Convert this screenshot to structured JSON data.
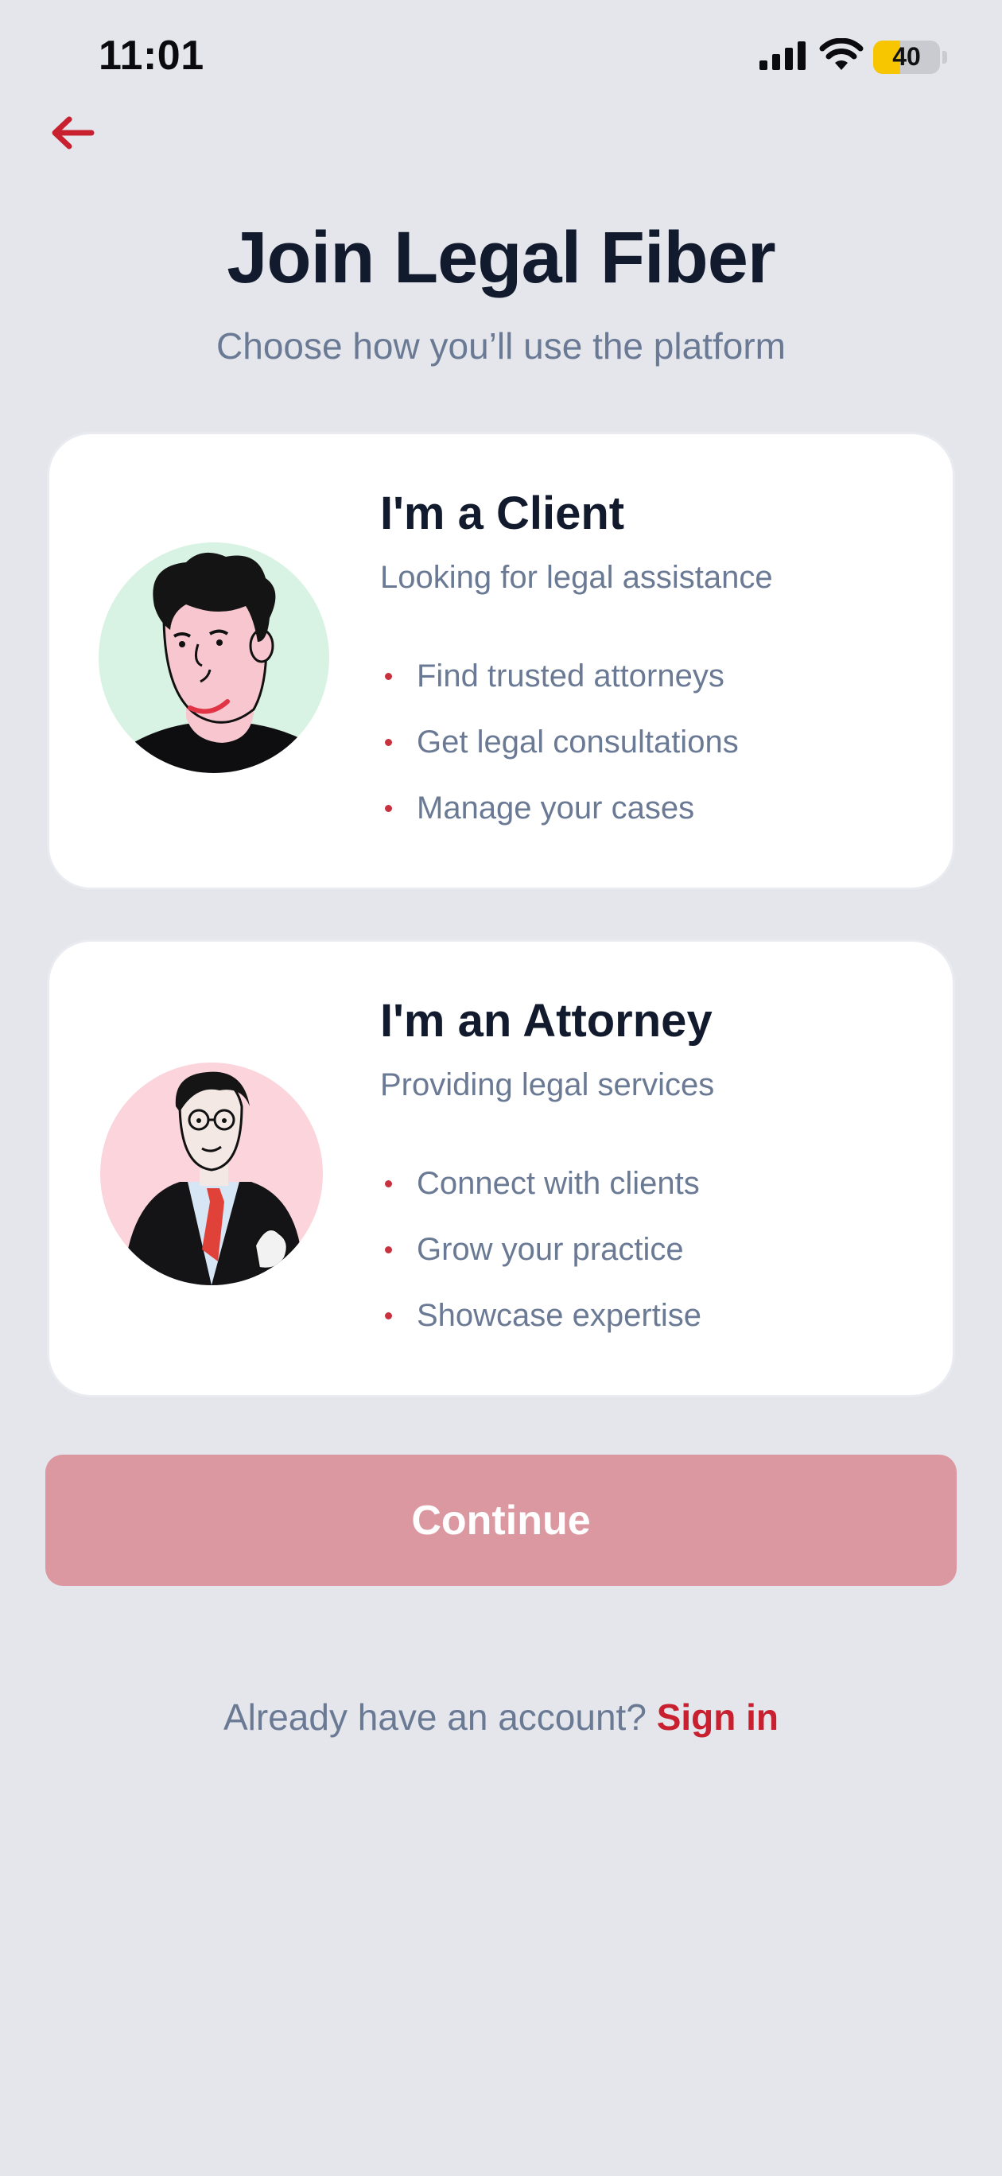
{
  "status_bar": {
    "time": "11:01",
    "battery_level": "40",
    "battery_fraction": 0.4,
    "battery_color": "#F7C600"
  },
  "header": {
    "back_icon": "arrow-left-icon",
    "title": "Join Legal Fiber",
    "subtitle": "Choose how you’ll use the platform"
  },
  "roles": [
    {
      "title": "I'm a Client",
      "subtitle": "Looking for legal assistance",
      "features": [
        "Find trusted attorneys",
        "Get legal consultations",
        "Manage your cases"
      ],
      "avatar": "client-avatar",
      "avatar_bg": "#D8F3E3"
    },
    {
      "title": "I'm an Attorney",
      "subtitle": "Providing legal services",
      "features": [
        "Connect with clients",
        "Grow your practice",
        "Showcase expertise"
      ],
      "avatar": "attorney-avatar",
      "avatar_bg": "#FBD4DC"
    }
  ],
  "continue": {
    "label": "Continue"
  },
  "footer": {
    "prompt": "Already have an account?",
    "link": "Sign in"
  },
  "colors": {
    "accent": "#C8202F",
    "button_disabled": "#DC98A0",
    "background": "#E4E6EC"
  }
}
